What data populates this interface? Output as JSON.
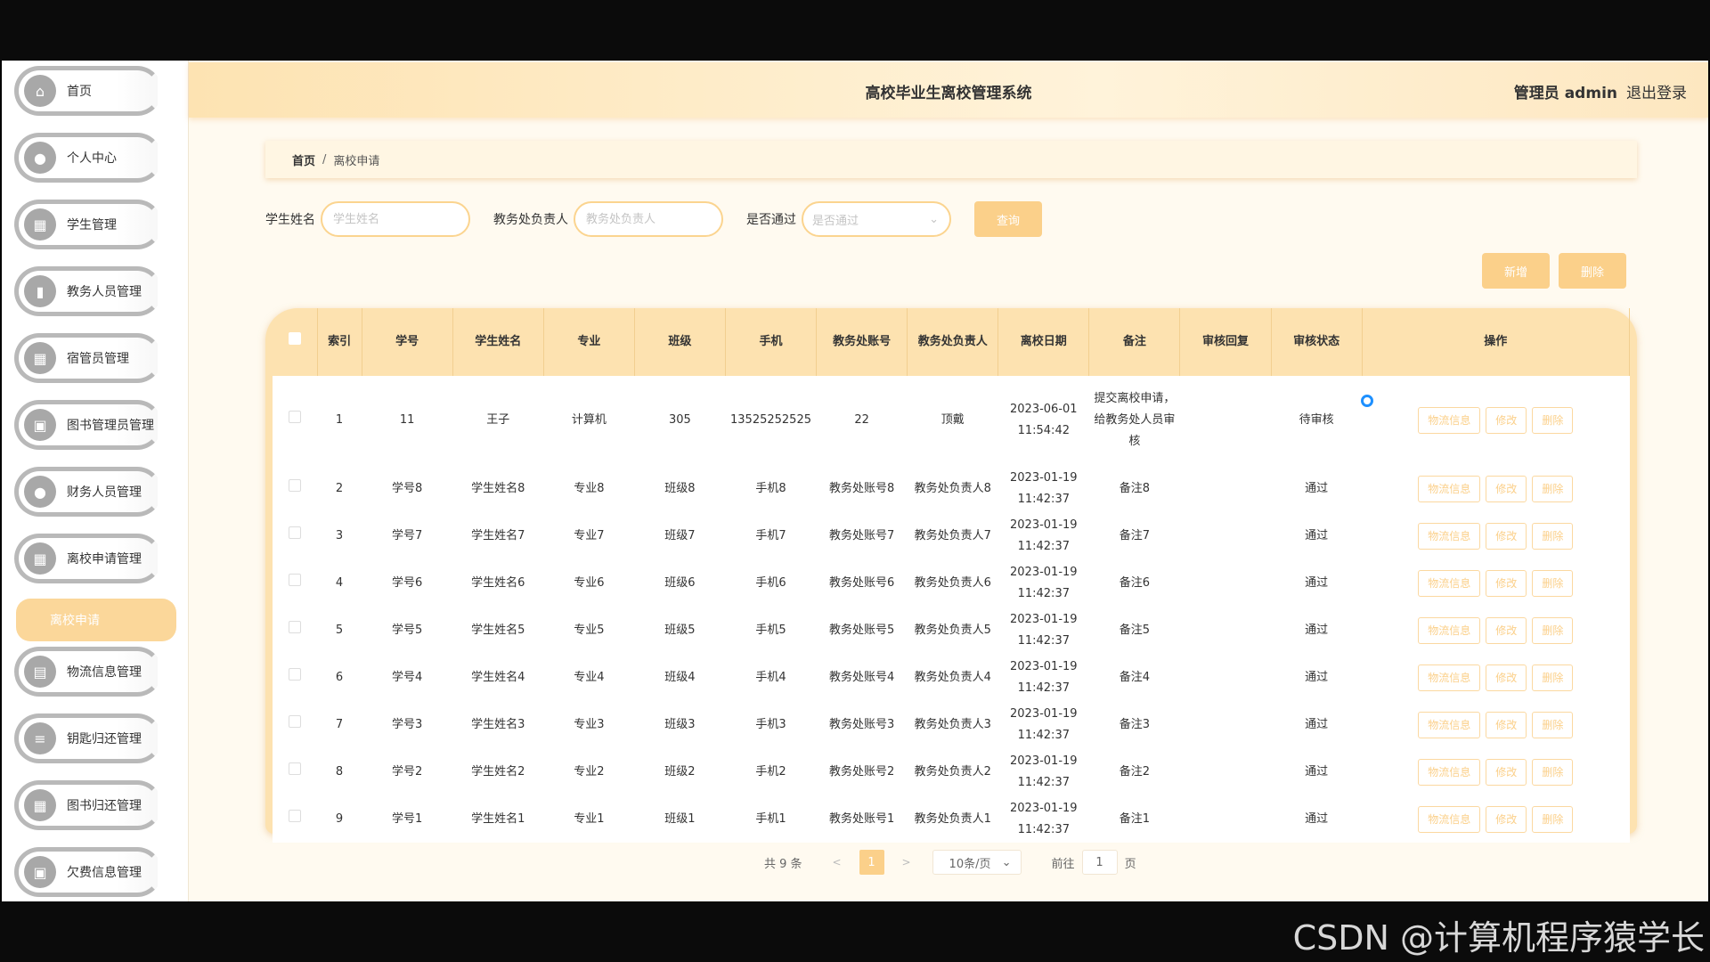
{
  "watermark": "CSDN @计算机程序猿学长",
  "header": {
    "title": "高校毕业生离校管理系统",
    "user": "管理员 admin",
    "logout": "退出登录"
  },
  "sidebar": {
    "items": [
      {
        "label": "首页",
        "icon": "home-icon"
      },
      {
        "label": "个人中心",
        "icon": "user-icon"
      },
      {
        "label": "学生管理",
        "icon": "grid-icon"
      },
      {
        "label": "教务人员管理",
        "icon": "bar-chart-icon"
      },
      {
        "label": "宿管员管理",
        "icon": "grid-icon"
      },
      {
        "label": "图书管理员管理",
        "icon": "monitor-icon"
      },
      {
        "label": "财务人员管理",
        "icon": "user-icon"
      },
      {
        "label": "离校申请管理",
        "icon": "grid-icon"
      },
      {
        "label": "物流信息管理",
        "icon": "document-icon"
      },
      {
        "label": "钥匙归还管理",
        "icon": "list-icon"
      },
      {
        "label": "图书归还管理",
        "icon": "grid-icon"
      },
      {
        "label": "欠费信息管理",
        "icon": "monitor-icon"
      }
    ],
    "active_sub": "离校申请"
  },
  "breadcrumb": {
    "home": "首页",
    "sep": "/",
    "current": "离校申请"
  },
  "search": {
    "name_label": "学生姓名",
    "name_placeholder": "学生姓名",
    "officer_label": "教务处负责人",
    "officer_placeholder": "教务处负责人",
    "pass_label": "是否通过",
    "pass_placeholder": "是否通过",
    "query_button": "查询"
  },
  "actions": {
    "add": "新增",
    "delete": "删除"
  },
  "table": {
    "headers": [
      "索引",
      "学号",
      "学生姓名",
      "专业",
      "班级",
      "手机",
      "教务处账号",
      "教务处负责人",
      "离校日期",
      "备注",
      "审核回复",
      "审核状态",
      "操作"
    ],
    "rows": [
      {
        "idx": "1",
        "sno": "11",
        "name": "王子",
        "major": "计算机",
        "cls": "305",
        "phone": "13525252525",
        "acct": "22",
        "officer": "顶戴",
        "date": "2023-06-01 11:54:42",
        "note": "提交离校申请，给教务处人员审核",
        "reply": "",
        "status": "待审核"
      },
      {
        "idx": "2",
        "sno": "学号8",
        "name": "学生姓名8",
        "major": "专业8",
        "cls": "班级8",
        "phone": "手机8",
        "acct": "教务处账号8",
        "officer": "教务处负责人8",
        "date": "2023-01-19 11:42:37",
        "note": "备注8",
        "reply": "",
        "status": "通过"
      },
      {
        "idx": "3",
        "sno": "学号7",
        "name": "学生姓名7",
        "major": "专业7",
        "cls": "班级7",
        "phone": "手机7",
        "acct": "教务处账号7",
        "officer": "教务处负责人7",
        "date": "2023-01-19 11:42:37",
        "note": "备注7",
        "reply": "",
        "status": "通过"
      },
      {
        "idx": "4",
        "sno": "学号6",
        "name": "学生姓名6",
        "major": "专业6",
        "cls": "班级6",
        "phone": "手机6",
        "acct": "教务处账号6",
        "officer": "教务处负责人6",
        "date": "2023-01-19 11:42:37",
        "note": "备注6",
        "reply": "",
        "status": "通过"
      },
      {
        "idx": "5",
        "sno": "学号5",
        "name": "学生姓名5",
        "major": "专业5",
        "cls": "班级5",
        "phone": "手机5",
        "acct": "教务处账号5",
        "officer": "教务处负责人5",
        "date": "2023-01-19 11:42:37",
        "note": "备注5",
        "reply": "",
        "status": "通过"
      },
      {
        "idx": "6",
        "sno": "学号4",
        "name": "学生姓名4",
        "major": "专业4",
        "cls": "班级4",
        "phone": "手机4",
        "acct": "教务处账号4",
        "officer": "教务处负责人4",
        "date": "2023-01-19 11:42:37",
        "note": "备注4",
        "reply": "",
        "status": "通过"
      },
      {
        "idx": "7",
        "sno": "学号3",
        "name": "学生姓名3",
        "major": "专业3",
        "cls": "班级3",
        "phone": "手机3",
        "acct": "教务处账号3",
        "officer": "教务处负责人3",
        "date": "2023-01-19 11:42:37",
        "note": "备注3",
        "reply": "",
        "status": "通过"
      },
      {
        "idx": "8",
        "sno": "学号2",
        "name": "学生姓名2",
        "major": "专业2",
        "cls": "班级2",
        "phone": "手机2",
        "acct": "教务处账号2",
        "officer": "教务处负责人2",
        "date": "2023-01-19 11:42:37",
        "note": "备注2",
        "reply": "",
        "status": "通过"
      },
      {
        "idx": "9",
        "sno": "学号1",
        "name": "学生姓名1",
        "major": "专业1",
        "cls": "班级1",
        "phone": "手机1",
        "acct": "教务处账号1",
        "officer": "教务处负责人1",
        "date": "2023-01-19 11:42:37",
        "note": "备注1",
        "reply": "",
        "status": "通过"
      }
    ],
    "row_actions": [
      "物流信息",
      "修改",
      "删除"
    ]
  },
  "pager": {
    "total": "共 9 条",
    "prev": "<",
    "current_page": "1",
    "next": ">",
    "page_size": "10条/页",
    "goto_label": "前往",
    "goto_value": "1",
    "goto_unit": "页"
  },
  "colors": {
    "accent": "#fbd08a",
    "header_bg": "#fde3b2",
    "table_head": "#fde2b0"
  }
}
